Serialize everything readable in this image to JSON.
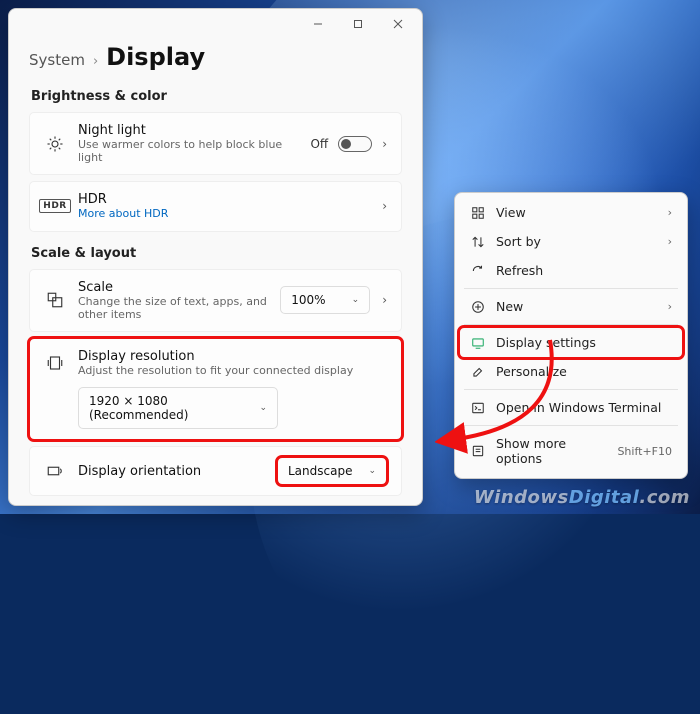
{
  "breadcrumb": {
    "parent": "System",
    "sep": "›",
    "current": "Display"
  },
  "sections": {
    "brightness": "Brightness & color",
    "scale": "Scale & layout"
  },
  "nightlight": {
    "title": "Night light",
    "sub": "Use warmer colors to help block blue light",
    "state": "Off"
  },
  "hdr": {
    "title": "HDR",
    "link": "More about HDR",
    "badge": "HDR"
  },
  "scale": {
    "title": "Scale",
    "sub": "Change the size of text, apps, and other items",
    "value": "100%"
  },
  "resolution": {
    "title": "Display resolution",
    "sub": "Adjust the resolution to fit your connected display",
    "value": "1920 × 1080 (Recommended)"
  },
  "orientation": {
    "title": "Display orientation",
    "value": "Landscape"
  },
  "context_menu": {
    "view": "View",
    "sort": "Sort by",
    "refresh": "Refresh",
    "new": "New",
    "display_settings": "Display settings",
    "personalize": "Personalize",
    "terminal": "Open in Windows Terminal",
    "more": "Show more options",
    "more_shortcut": "Shift+F10"
  },
  "watermark": {
    "a": "Windows",
    "b": "Digital",
    "c": ".com"
  }
}
